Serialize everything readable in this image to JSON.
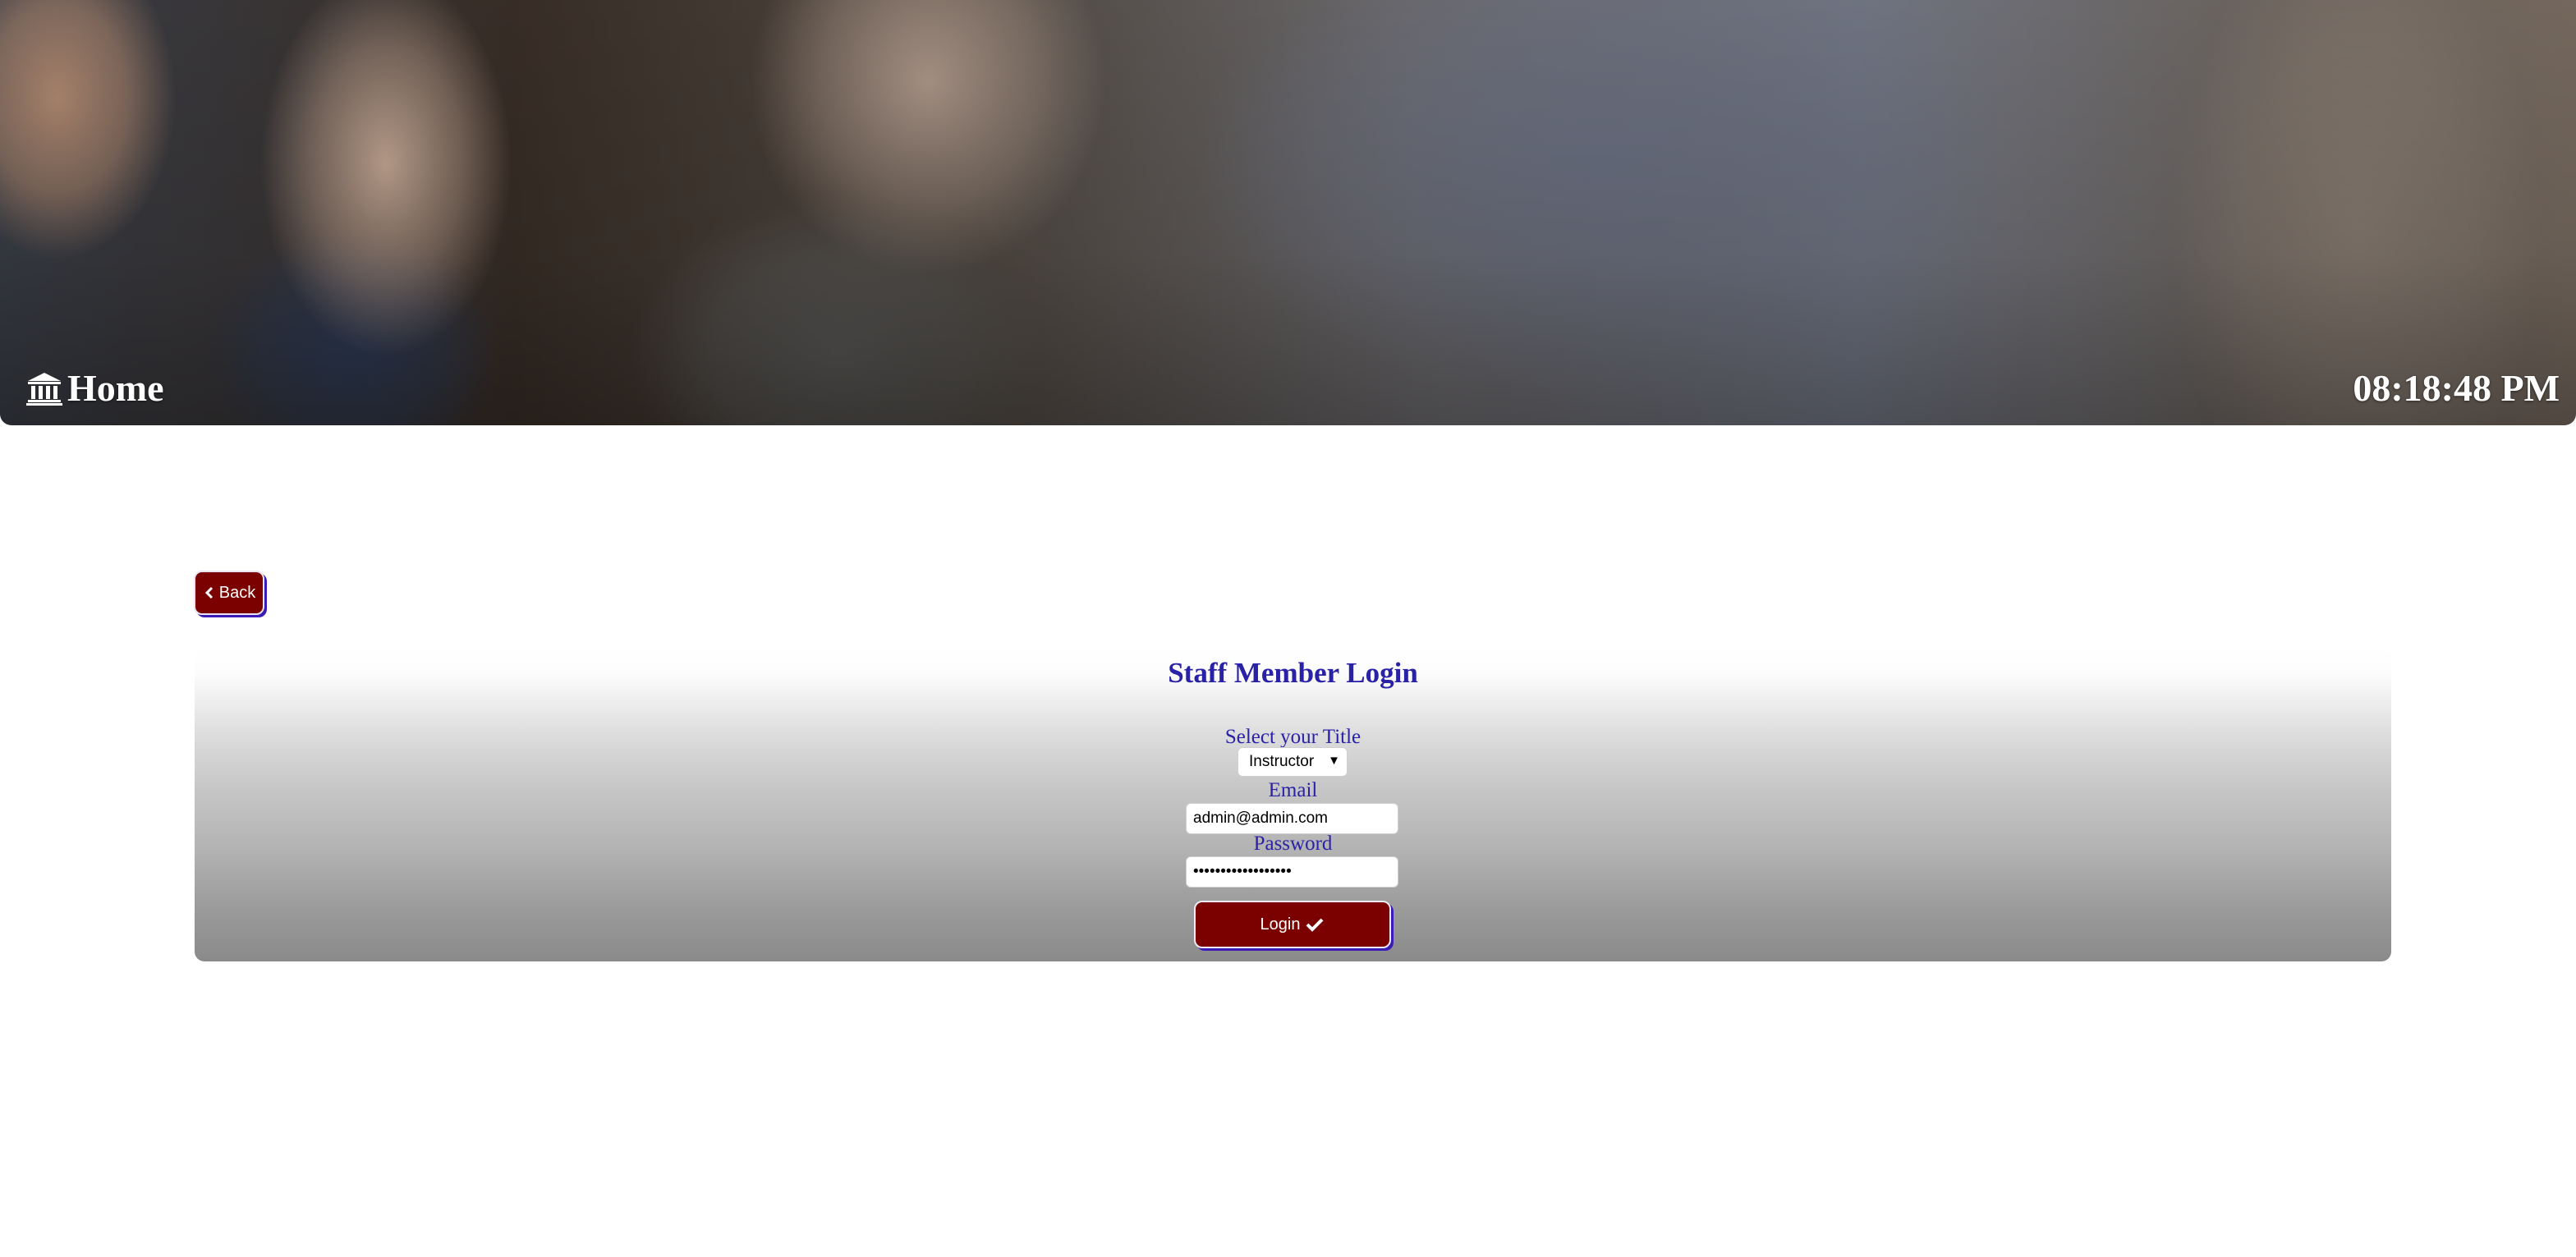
{
  "header": {
    "home_label": "Home",
    "home_icon": "bank-building-icon",
    "clock": "08:18:48 PM"
  },
  "back_button": {
    "label": "Back",
    "icon": "chevron-left-icon"
  },
  "login_form": {
    "title": "Staff Member Login",
    "title_select_label": "Select your Title",
    "title_selected": "Instructor",
    "email_label": "Email",
    "email_value": "admin@admin.com",
    "password_label": "Password",
    "password_value": "••••••••••••••••••",
    "submit_label": "Login",
    "submit_icon": "checkmark-icon"
  },
  "colors": {
    "accent_maroon": "#7b0000",
    "text_blue": "#2a22a6",
    "button_shadow": "#3b1bb5"
  }
}
